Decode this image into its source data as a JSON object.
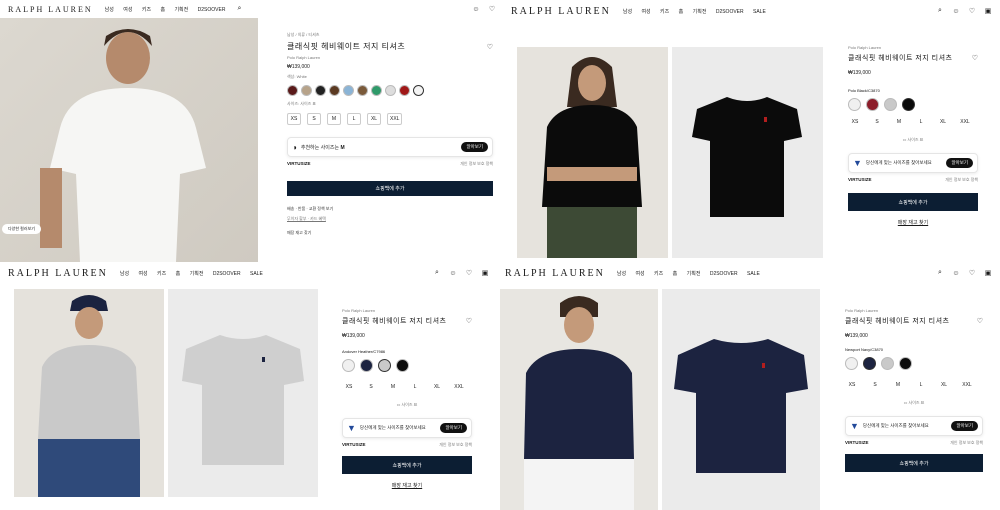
{
  "header": {
    "logo": "RALPH LAUREN",
    "nav_a": [
      "남성",
      "여성",
      "키즈",
      "홈",
      "기획전",
      "D2SOOVER"
    ],
    "nav_b": [
      "남성",
      "여성",
      "키즈",
      "홈",
      "기획전",
      "D2SOOVER",
      "SALE"
    ]
  },
  "product": {
    "title": "클래식핏 헤비웨이트 저지 티셔츠",
    "brand": "Polo Ralph Lauren",
    "brand_short": "Polo Ralph Lauren",
    "price": "₩139,000",
    "cart_button": "쇼핑백에 추가",
    "store_link": "매장 재고 찾기",
    "size_guide": "사이즈 표",
    "virtusize": "VIRTUSIZE",
    "vs_text": "당신에게 맞는 사이즈를 찾아보세요",
    "vs_button": "알아보기",
    "vs_fine": "개인 정보 보호 정책",
    "sizes": [
      "XS",
      "S",
      "M",
      "L",
      "XL",
      "XXL"
    ]
  },
  "q1": {
    "breadcrumb": "남성 / 의류 / 티셔츠",
    "color_label": "색상: White",
    "size_label": "사이즈:",
    "size_guide_small": "사이즈 표",
    "vs_text": "추천하는 사이즈는",
    "vs_size": "M",
    "vs_button": "알아보기",
    "shipping": "배송 · 반품 · 교환 정책 보기",
    "pay": "무이자 할부 · 카드 혜택",
    "store": "매장 재고 찾기",
    "chip": "다양한 컬러보기"
  },
  "q2": {
    "color_label": "Polo Black/C3870"
  },
  "q3": {
    "color_label": "Andover Heather/C7986"
  },
  "q4": {
    "color_label": "Newport Navy/C3870"
  },
  "colors": {
    "black_tee": "#0b0b0b",
    "grey_tee": "#c9c9c9",
    "navy_tee": "#1c2340",
    "cart_bg": "#0c1e33"
  }
}
